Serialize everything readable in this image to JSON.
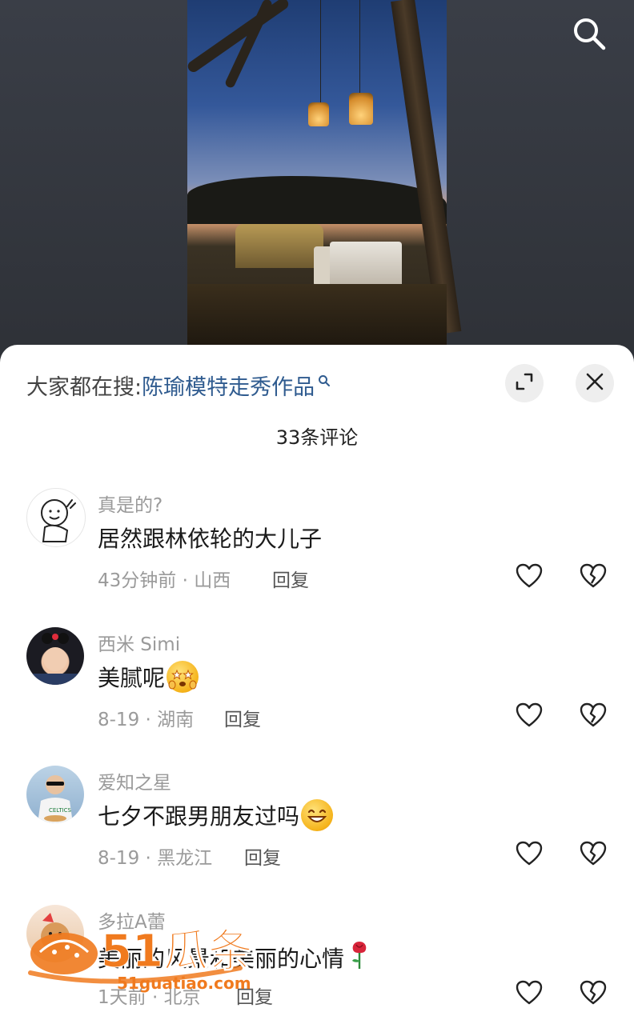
{
  "search": {
    "prefix": "大家都在搜:",
    "term": "陈瑜模特走秀作品"
  },
  "comments_header": {
    "count_label": "33条评论"
  },
  "comments": [
    {
      "name": "真是的?",
      "text": "居然跟林依轮的大儿子",
      "meta": "43分钟前 · 山西",
      "reply": "回复"
    },
    {
      "name": "西米 Simi",
      "text": "美腻呢",
      "meta": "8-19 · 湖南",
      "reply": "回复"
    },
    {
      "name": "爱知之星",
      "text": "七夕不跟男朋友过吗",
      "meta": "8-19 · 黑龙江",
      "reply": "回复"
    },
    {
      "name": "多拉A蕾",
      "text": "美丽的风景和美丽的心情",
      "meta": "1天前 · 北京",
      "reply": "回复"
    }
  ],
  "watermark": {
    "brand": "51瓜条",
    "url": "51guatiao.com"
  },
  "icons": {
    "top_search": "search-icon",
    "expand": "expand-icon",
    "close": "close-icon",
    "like": "heart-icon",
    "dislike": "broken-heart-icon"
  },
  "colors": {
    "search_term": "#2f5b8f",
    "watermark": "#f07a1e"
  }
}
